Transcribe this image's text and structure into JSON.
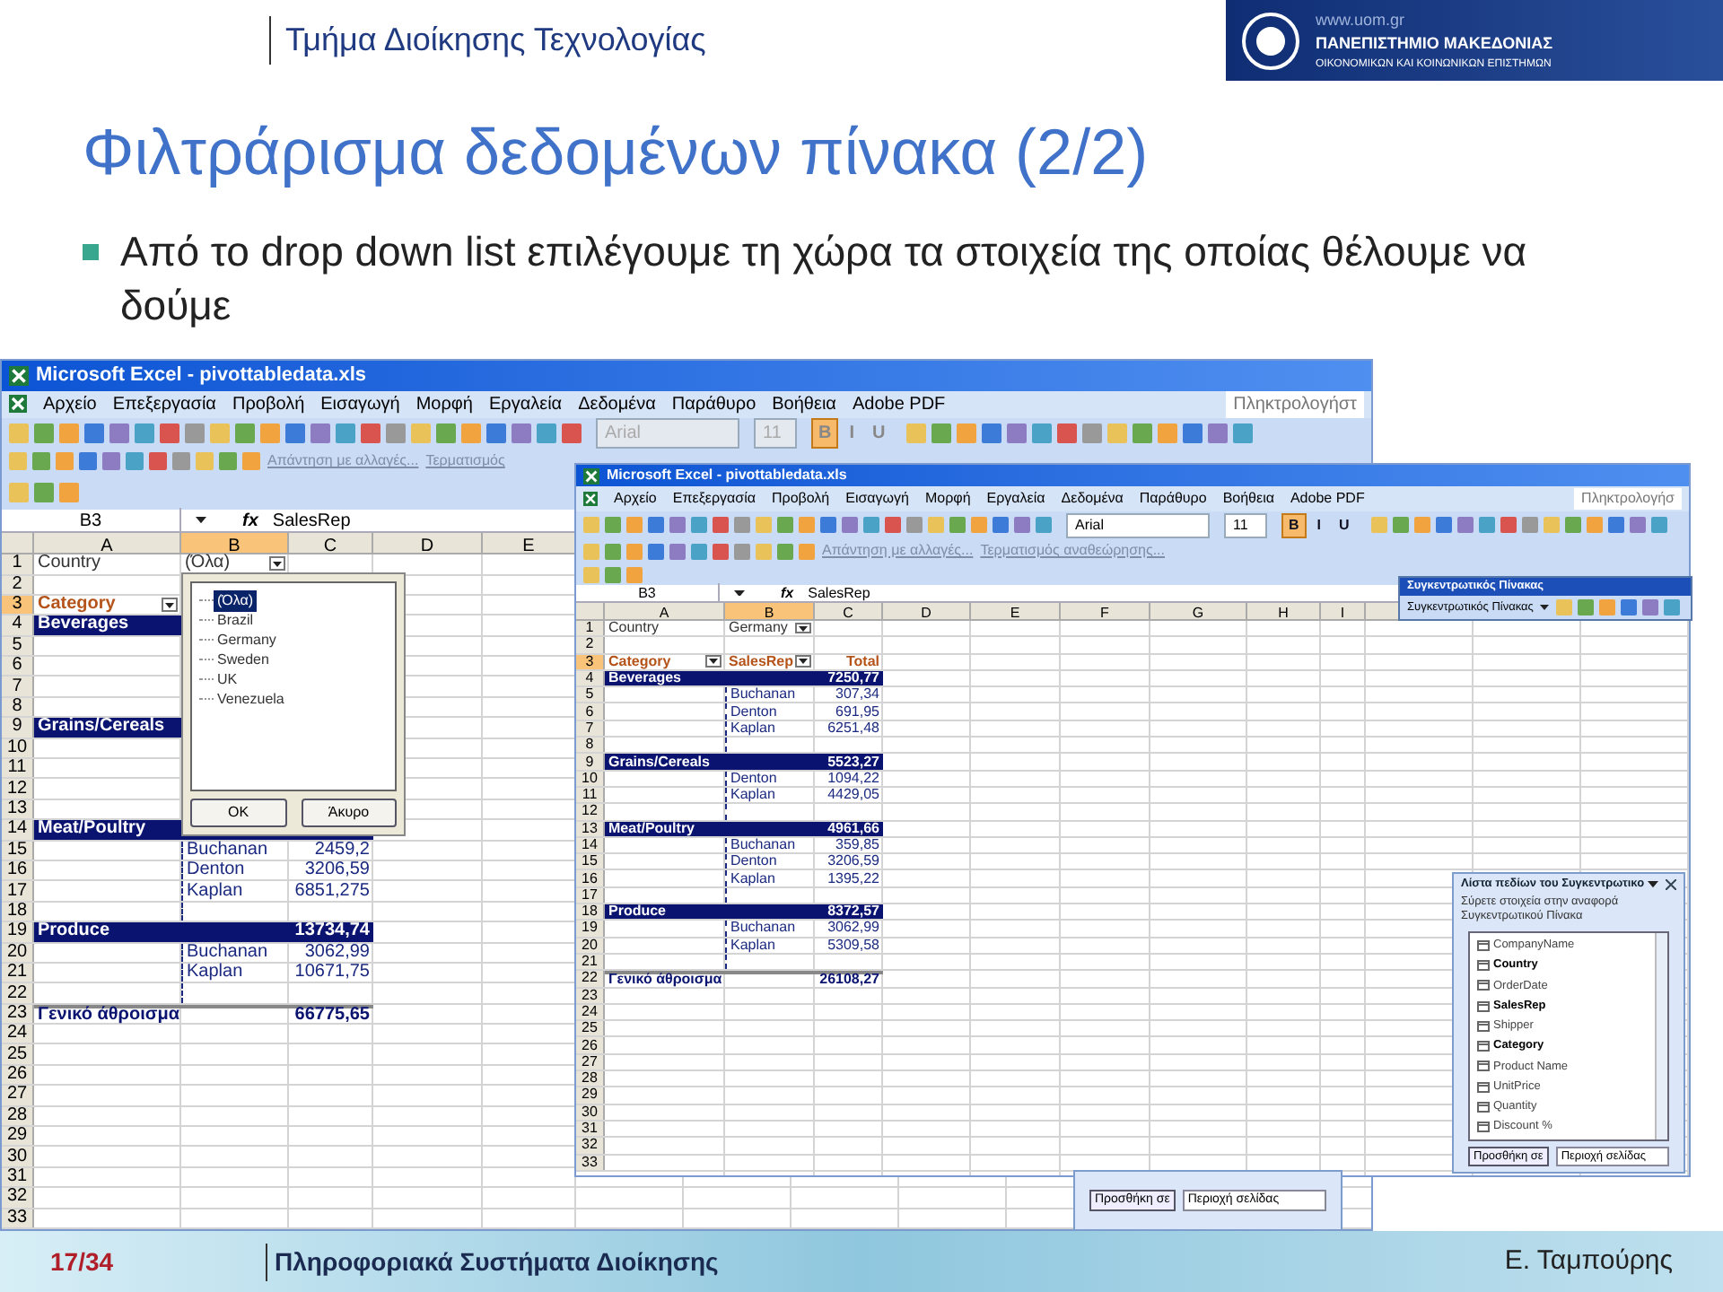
{
  "header": {
    "department": "Τμήμα Διοίκησης Τεχνολογίας",
    "logo": {
      "url": "www.uom.gr",
      "name": "ΠΑΝΕΠΙΣΤΗΜΙΟ ΜΑΚΕΔΟΝΙΑΣ",
      "subtitle": "ΟΙΚΟΝΟΜΙΚΩΝ ΚΑΙ ΚΟΙΝΩΝΙΚΩΝ ΕΠΙΣΤΗΜΩΝ"
    }
  },
  "title": "Φιλτράρισμα δεδομένων πίνακα (2/2)",
  "bullets": [
    "Από το drop down list επιλέγουμε τη χώρα τα στοιχεία της οποίας θέλουμε να δούμε"
  ],
  "screenshots": [
    {
      "window_title": "Microsoft Excel - pivottabledata.xls",
      "menu": [
        "Αρχείο",
        "Επεξεργασία",
        "Προβολή",
        "Εισαγωγή",
        "Μορφή",
        "Εργαλεία",
        "Δεδομένα",
        "Παράθυρο",
        "Βοήθεια",
        "Adobe PDF"
      ],
      "help_box": "Πληκτρολογήστ",
      "format_bar": {
        "font": "Arial",
        "size": "11",
        "disabled": true,
        "buttons": [
          {
            "label": "B",
            "selected": true
          },
          {
            "label": "I",
            "selected": false
          },
          {
            "label": "U",
            "selected": false
          }
        ]
      },
      "review_bar": [
        "Απάντηση με αλλαγές...",
        "Τερματισμός"
      ],
      "formula_bar": {
        "cell": "B3",
        "fx": "fx",
        "value": "SalesRep"
      },
      "columns": [
        {
          "label": "A",
          "selected": false
        },
        {
          "label": "B",
          "selected": true
        },
        {
          "label": "C",
          "selected": false
        },
        {
          "label": "D",
          "selected": false
        },
        {
          "label": "E",
          "selected": false
        }
      ],
      "rows": [
        {
          "n": "1",
          "kind": "page",
          "selected": false,
          "cells": [
            {
              "text": "Country",
              "dropdown": false
            },
            {
              "text": "(Όλα)",
              "dropdown": true
            }
          ]
        },
        {
          "n": "2",
          "kind": "plain",
          "selected": false
        },
        {
          "n": "3",
          "kind": "header",
          "selected": true,
          "cells": [
            {
              "text": "Category",
              "dropdown": true
            },
            null,
            null
          ]
        },
        {
          "n": "4",
          "kind": "band",
          "selected": false,
          "cells": [
            "Beverages",
            null,
            null
          ]
        },
        {
          "n": "5",
          "kind": "plain",
          "selected": false,
          "cells": [
            null,
            null,
            null
          ]
        },
        {
          "n": "6",
          "kind": "plain",
          "selected": false,
          "cells": [
            null,
            null,
            null
          ]
        },
        {
          "n": "7",
          "kind": "plain",
          "selected": false,
          "cells": [
            null,
            null,
            null
          ]
        },
        {
          "n": "8",
          "kind": "plain",
          "selected": false,
          "cells": [
            null,
            null,
            null
          ]
        },
        {
          "n": "9",
          "kind": "band",
          "selected": false,
          "cells": [
            "Grains/Cereals",
            null,
            null
          ]
        },
        {
          "n": "10",
          "kind": "plain",
          "selected": false,
          "cells": [
            null,
            null,
            null
          ]
        },
        {
          "n": "11",
          "kind": "plain",
          "selected": false,
          "cells": [
            null,
            null,
            null
          ]
        },
        {
          "n": "12",
          "kind": "plain",
          "selected": false,
          "cells": [
            null,
            null,
            null
          ]
        },
        {
          "n": "13",
          "kind": "plain",
          "selected": false,
          "cells": [
            null,
            null,
            null
          ]
        },
        {
          "n": "14",
          "kind": "band",
          "selected": false,
          "cells": [
            "Meat/Poultry",
            null,
            null
          ]
        },
        {
          "n": "15",
          "kind": "plain",
          "selected": false,
          "cells": [
            null,
            "Buchanan",
            "2459,2"
          ]
        },
        {
          "n": "16",
          "kind": "plain",
          "selected": false,
          "cells": [
            null,
            "Denton",
            "3206,59"
          ]
        },
        {
          "n": "17",
          "kind": "plain",
          "selected": false,
          "cells": [
            null,
            "Kaplan",
            "6851,275"
          ]
        },
        {
          "n": "18",
          "kind": "plain",
          "selected": false,
          "cells": [
            null,
            null,
            null
          ]
        },
        {
          "n": "19",
          "kind": "band",
          "selected": false,
          "cells": [
            "Produce",
            null,
            "13734,74"
          ]
        },
        {
          "n": "20",
          "kind": "plain",
          "selected": false,
          "cells": [
            null,
            "Buchanan",
            "3062,99"
          ]
        },
        {
          "n": "21",
          "kind": "plain",
          "selected": false,
          "cells": [
            null,
            "Kaplan",
            "10671,75"
          ]
        },
        {
          "n": "22",
          "kind": "plain",
          "selected": false,
          "cells": [
            null,
            null,
            null
          ]
        },
        {
          "n": "23",
          "kind": "total",
          "selected": false,
          "cells": [
            "Γενικό άθροισμα",
            null,
            "66775,65"
          ]
        },
        {
          "n": "24",
          "kind": "plain",
          "selected": false
        },
        {
          "n": "25",
          "kind": "plain",
          "selected": false
        },
        {
          "n": "26",
          "kind": "plain",
          "selected": false
        },
        {
          "n": "27",
          "kind": "plain",
          "selected": false
        },
        {
          "n": "28",
          "kind": "plain",
          "selected": false
        },
        {
          "n": "29",
          "kind": "plain",
          "selected": false
        },
        {
          "n": "30",
          "kind": "plain",
          "selected": false
        },
        {
          "n": "31",
          "kind": "plain",
          "selected": false
        },
        {
          "n": "32",
          "kind": "plain",
          "selected": false
        },
        {
          "n": "33",
          "kind": "plain",
          "selected": false
        }
      ],
      "filter_list": {
        "items": [
          {
            "label": "(Όλα)",
            "selected": true
          },
          {
            "label": "Brazil",
            "selected": false
          },
          {
            "label": "Germany",
            "selected": false
          },
          {
            "label": "Sweden",
            "selected": false
          },
          {
            "label": "UK",
            "selected": false
          },
          {
            "label": "Venezuela",
            "selected": false
          }
        ],
        "buttons": [
          "OK",
          "Άκυρο"
        ]
      }
    },
    {
      "window_title": "Microsoft Excel - pivottabledata.xls",
      "menu": [
        "Αρχείο",
        "Επεξεργασία",
        "Προβολή",
        "Εισαγωγή",
        "Μορφή",
        "Εργαλεία",
        "Δεδομένα",
        "Παράθυρο",
        "Βοήθεια",
        "Adobe PDF"
      ],
      "help_box": "Πληκτρολογήσ",
      "format_bar": {
        "font": "Arial",
        "size": "11",
        "disabled": false,
        "buttons": [
          {
            "label": "B",
            "selected": true
          },
          {
            "label": "I",
            "selected": false
          },
          {
            "label": "U",
            "selected": false
          }
        ]
      },
      "review_bar": [
        "Απάντηση με αλλαγές...",
        "Τερματισμός αναθεώρησης..."
      ],
      "formula_bar": {
        "cell": "B3",
        "fx": "fx",
        "value": "SalesRep"
      },
      "columns": [
        {
          "label": "A",
          "selected": false
        },
        {
          "label": "B",
          "selected": true
        },
        {
          "label": "C",
          "selected": false
        },
        {
          "label": "D",
          "selected": false
        },
        {
          "label": "E",
          "selected": false
        },
        {
          "label": "F",
          "selected": false
        },
        {
          "label": "G",
          "selected": false
        },
        {
          "label": "H",
          "selected": false
        },
        {
          "label": "I",
          "selected": false
        }
      ],
      "rows": [
        {
          "n": "1",
          "kind": "page",
          "selected": false,
          "cells": [
            {
              "text": "Country",
              "dropdown": false
            },
            {
              "text": "Germany",
              "dropdown": true
            }
          ]
        },
        {
          "n": "2",
          "kind": "plain",
          "selected": false
        },
        {
          "n": "3",
          "kind": "header",
          "selected": true,
          "cells": [
            {
              "text": "Category",
              "dropdown": true
            },
            {
              "text": "SalesRep",
              "dropdown": true
            },
            {
              "text": "Total",
              "dropdown": false
            }
          ]
        },
        {
          "n": "4",
          "kind": "band",
          "selected": false,
          "cells": [
            "Beverages",
            null,
            "7250,77"
          ]
        },
        {
          "n": "5",
          "kind": "plain",
          "selected": false,
          "cells": [
            null,
            "Buchanan",
            "307,34"
          ]
        },
        {
          "n": "6",
          "kind": "plain",
          "selected": false,
          "cells": [
            null,
            "Denton",
            "691,95"
          ]
        },
        {
          "n": "7",
          "kind": "plain",
          "selected": false,
          "cells": [
            null,
            "Kaplan",
            "6251,48"
          ]
        },
        {
          "n": "8",
          "kind": "plain",
          "selected": false,
          "cells": [
            null,
            null,
            null
          ]
        },
        {
          "n": "9",
          "kind": "band",
          "selected": false,
          "cells": [
            "Grains/Cereals",
            null,
            "5523,27"
          ]
        },
        {
          "n": "10",
          "kind": "plain",
          "selected": false,
          "cells": [
            null,
            "Denton",
            "1094,22"
          ]
        },
        {
          "n": "11",
          "kind": "plain",
          "selected": false,
          "cells": [
            null,
            "Kaplan",
            "4429,05"
          ]
        },
        {
          "n": "12",
          "kind": "plain",
          "selected": false,
          "cells": [
            null,
            null,
            null
          ]
        },
        {
          "n": "13",
          "kind": "band",
          "selected": false,
          "cells": [
            "Meat/Poultry",
            null,
            "4961,66"
          ]
        },
        {
          "n": "14",
          "kind": "plain",
          "selected": false,
          "cells": [
            null,
            "Buchanan",
            "359,85"
          ]
        },
        {
          "n": "15",
          "kind": "plain",
          "selected": false,
          "cells": [
            null,
            "Denton",
            "3206,59"
          ]
        },
        {
          "n": "16",
          "kind": "plain",
          "selected": false,
          "cells": [
            null,
            "Kaplan",
            "1395,22"
          ]
        },
        {
          "n": "17",
          "kind": "plain",
          "selected": false,
          "cells": [
            null,
            null,
            null
          ]
        },
        {
          "n": "18",
          "kind": "band",
          "selected": false,
          "cells": [
            "Produce",
            null,
            "8372,57"
          ]
        },
        {
          "n": "19",
          "kind": "plain",
          "selected": false,
          "cells": [
            null,
            "Buchanan",
            "3062,99"
          ]
        },
        {
          "n": "20",
          "kind": "plain",
          "selected": false,
          "cells": [
            null,
            "Kaplan",
            "5309,58"
          ]
        },
        {
          "n": "21",
          "kind": "plain",
          "selected": false,
          "cells": [
            null,
            null,
            null
          ]
        },
        {
          "n": "22",
          "kind": "total",
          "selected": false,
          "cells": [
            "Γενικό άθροισμα",
            null,
            "26108,27"
          ]
        },
        {
          "n": "23",
          "kind": "plain",
          "selected": false
        },
        {
          "n": "24",
          "kind": "plain",
          "selected": false
        },
        {
          "n": "25",
          "kind": "plain",
          "selected": false
        },
        {
          "n": "26",
          "kind": "plain",
          "selected": false
        },
        {
          "n": "27",
          "kind": "plain",
          "selected": false
        },
        {
          "n": "28",
          "kind": "plain",
          "selected": false
        },
        {
          "n": "29",
          "kind": "plain",
          "selected": false
        },
        {
          "n": "30",
          "kind": "plain",
          "selected": false
        },
        {
          "n": "31",
          "kind": "plain",
          "selected": false
        },
        {
          "n": "32",
          "kind": "plain",
          "selected": false
        },
        {
          "n": "33",
          "kind": "plain",
          "selected": false
        }
      ],
      "pivot_toolbar": {
        "title": "Συγκεντρωτικός Πίνακας",
        "menu": "Συγκεντρωτικός Πίνακας"
      },
      "field_list": {
        "title": "Λίστα πεδίων του Συγκεντρωτικο",
        "hint": "Σύρετε στοιχεία στην αναφορά Συγκεντρωτικού Πίνακα",
        "fields": [
          {
            "label": "CompanyName",
            "bold": false
          },
          {
            "label": "Country",
            "bold": true
          },
          {
            "label": "OrderDate",
            "bold": false
          },
          {
            "label": "SalesRep",
            "bold": true
          },
          {
            "label": "Shipper",
            "bold": false
          },
          {
            "label": "Category",
            "bold": true
          },
          {
            "label": "Product Name",
            "bold": false
          },
          {
            "label": "UnitPrice",
            "bold": false
          },
          {
            "label": "Quantity",
            "bold": false
          },
          {
            "label": "Discount %",
            "bold": false
          }
        ],
        "add_button": "Προσθήκη σε",
        "area": "Περιοχή σελίδας"
      }
    }
  ],
  "stray_panel": {
    "add_button": "Προσθήκη σε",
    "area": "Περιοχή σελίδας"
  },
  "footer": {
    "page": "17/34",
    "course": "Πληροφοριακά Συστήματα Διοίκησης",
    "author": "Ε. Ταμπούρης"
  }
}
